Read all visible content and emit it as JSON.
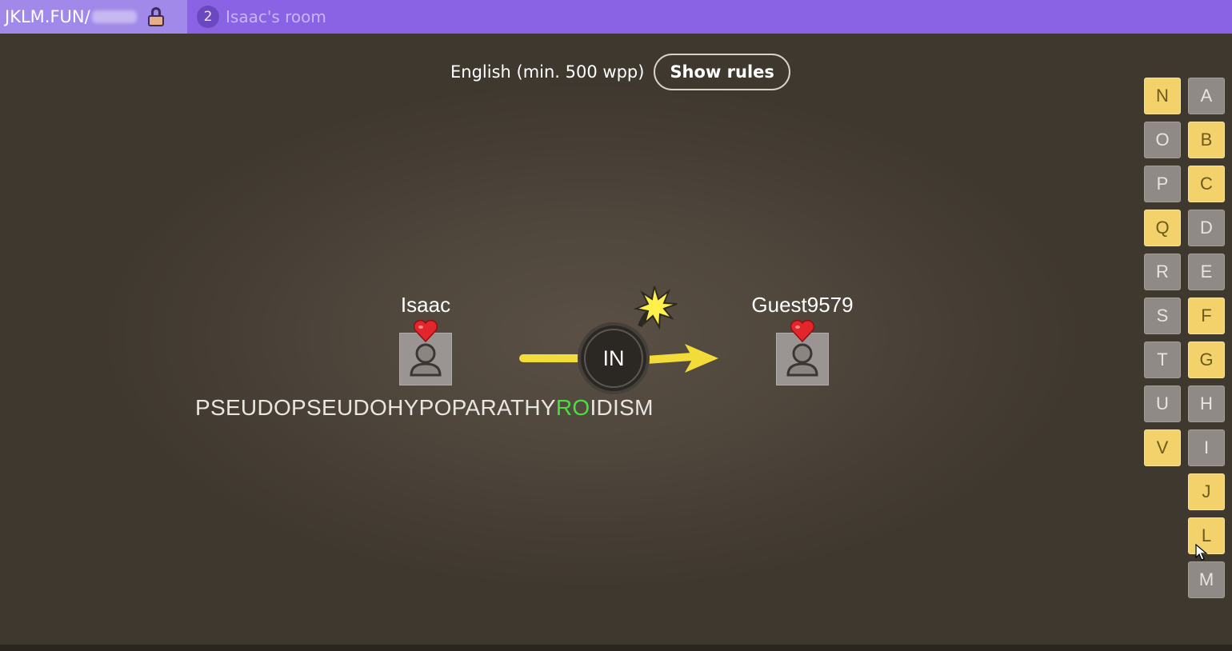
{
  "topbar": {
    "site": "JKLM.FUN/",
    "room_code": "",
    "player_count": "2",
    "room_name": "Isaac's room",
    "icons": [
      "lock-icon"
    ]
  },
  "header": {
    "language_label": "English (min. 500 wpp)",
    "rules_button": "Show rules"
  },
  "game": {
    "prompt": "IN",
    "players": [
      {
        "name": "Isaac",
        "lives_icon": "heart-icon",
        "avatar": "person-icon"
      },
      {
        "name": "Guest9579",
        "lives_icon": "heart-icon",
        "avatar": "person-icon"
      }
    ],
    "typed_word": {
      "before": "PSEUDOPSEUDOHYPOPARATHY",
      "highlight": "RO",
      "after": "IDISM"
    }
  },
  "bonus_letters": {
    "left_column": [
      {
        "letter": "N",
        "used": true
      },
      {
        "letter": "O",
        "used": false
      },
      {
        "letter": "P",
        "used": false
      },
      {
        "letter": "Q",
        "used": true
      },
      {
        "letter": "R",
        "used": false
      },
      {
        "letter": "S",
        "used": false
      },
      {
        "letter": "T",
        "used": false
      },
      {
        "letter": "U",
        "used": false
      },
      {
        "letter": "V",
        "used": true
      }
    ],
    "right_column": [
      {
        "letter": "A",
        "used": false
      },
      {
        "letter": "B",
        "used": true
      },
      {
        "letter": "C",
        "used": true
      },
      {
        "letter": "D",
        "used": false
      },
      {
        "letter": "E",
        "used": false
      },
      {
        "letter": "F",
        "used": true
      },
      {
        "letter": "G",
        "used": true
      },
      {
        "letter": "H",
        "used": false
      },
      {
        "letter": "I",
        "used": false
      },
      {
        "letter": "J",
        "used": true
      },
      {
        "letter": "L",
        "used": true
      },
      {
        "letter": "M",
        "used": false
      }
    ]
  },
  "colors": {
    "topbar": "#8a63e4",
    "letter_used": "#f3d26b",
    "letter_unused": "#8f8a85",
    "arrow": "#f2dc3a",
    "highlight": "#4ade41"
  }
}
